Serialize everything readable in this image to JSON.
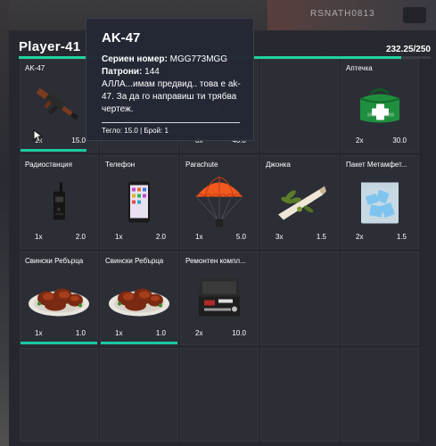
{
  "player": {
    "name": "Player-41"
  },
  "weight": {
    "label": "232.25/250",
    "fraction": 0.929
  },
  "background": {
    "sign": "RSNATH0813"
  },
  "slots": [
    {
      "label": "AK-47",
      "qty": "1x",
      "wt": "15.0",
      "icon": "rifle-icon",
      "durability": 0.86
    },
    {
      "label": "",
      "qty": "",
      "wt": "",
      "icon": "",
      "durability": 0
    },
    {
      "label": "",
      "qty": "8x",
      "wt": "40.0",
      "icon": "item-icon",
      "durability": 0
    },
    {
      "label": "",
      "qty": "",
      "wt": "",
      "icon": "",
      "durability": 0
    },
    {
      "label": "Аптечка",
      "qty": "2x",
      "wt": "30.0",
      "icon": "medkit-icon",
      "durability": 0
    },
    {
      "label": "Радиостанция",
      "qty": "1x",
      "wt": "2.0",
      "icon": "radio-icon",
      "durability": 0
    },
    {
      "label": "Телефон",
      "qty": "1x",
      "wt": "2.0",
      "icon": "phone-icon",
      "durability": 0
    },
    {
      "label": "Parachute",
      "qty": "1x",
      "wt": "5.0",
      "icon": "parachute-icon",
      "durability": 0
    },
    {
      "label": "Джонка",
      "qty": "3x",
      "wt": "1.5",
      "icon": "joint-icon",
      "durability": 0
    },
    {
      "label": "Пакет Метамфет...",
      "qty": "2x",
      "wt": "1.5",
      "icon": "meth-bag-icon",
      "durability": 0
    },
    {
      "label": "Свински Ребърца",
      "qty": "1x",
      "wt": "1.0",
      "icon": "ribs-icon",
      "durability": 1
    },
    {
      "label": "Свински Ребърца",
      "qty": "1x",
      "wt": "1.0",
      "icon": "ribs-icon",
      "durability": 1
    },
    {
      "label": "Ремонтен компл...",
      "qty": "2x",
      "wt": "10.0",
      "icon": "repair-kit-icon",
      "durability": 0
    },
    {
      "label": "",
      "qty": "",
      "wt": "",
      "icon": "",
      "durability": 0
    },
    {
      "label": "",
      "qty": "",
      "wt": "",
      "icon": "",
      "durability": 0
    },
    {
      "label": "",
      "qty": "",
      "wt": "",
      "icon": "",
      "durability": 0
    },
    {
      "label": "",
      "qty": "",
      "wt": "",
      "icon": "",
      "durability": 0
    },
    {
      "label": "",
      "qty": "",
      "wt": "",
      "icon": "",
      "durability": 0
    },
    {
      "label": "",
      "qty": "",
      "wt": "",
      "icon": "",
      "durability": 0
    },
    {
      "label": "",
      "qty": "",
      "wt": "",
      "icon": "",
      "durability": 0
    }
  ],
  "tooltip": {
    "title": "AK-47",
    "serial_label": "Сериен номер:",
    "serial_value": "MGG773MGG",
    "ammo_label": "Патрони:",
    "ammo_value": "144",
    "description": "АЛЛА...имам предвид.. това е ak-47. За да го направиш ти трябва чертеж.",
    "footer": "Тегло: 15.0 | Брой: 1"
  },
  "colors": {
    "accent": "#22d19c",
    "panel": "#262830",
    "slot": "#2c2e36"
  }
}
